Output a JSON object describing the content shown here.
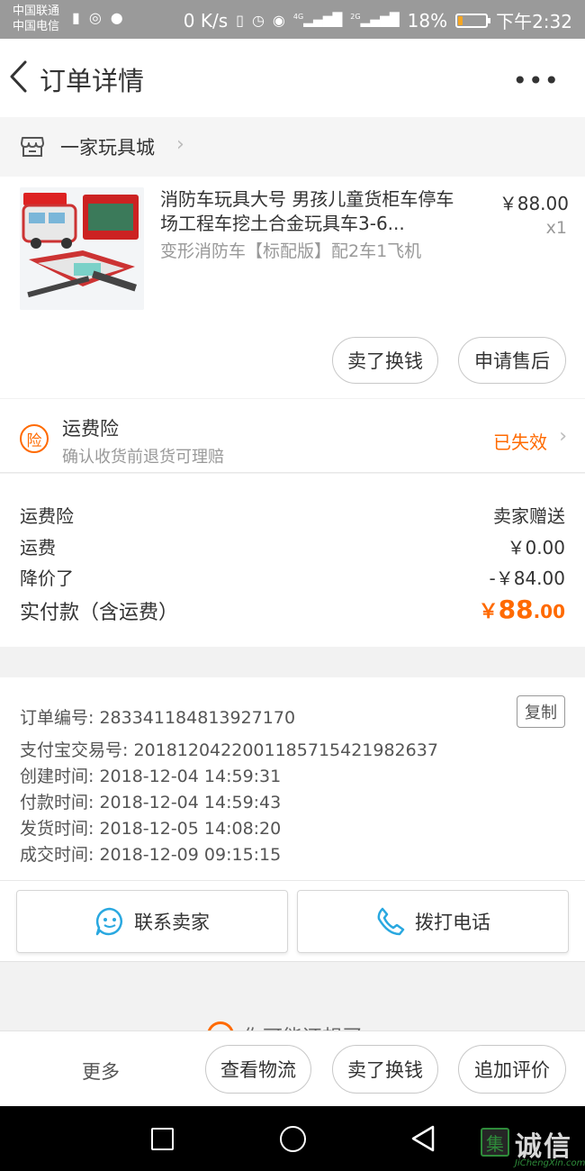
{
  "status_bar": {
    "carrier_1": "中国联通",
    "carrier_2": "中国电信",
    "speed": "0 K/s",
    "net_1": "4G",
    "net_2": "2G",
    "battery": "18%",
    "battery_level": 0.18,
    "time": "下午2:32"
  },
  "header": {
    "title": "订单详情",
    "more": "•••"
  },
  "store": {
    "name": "一家玩具城"
  },
  "product": {
    "title": "消防车玩具大号 男孩儿童货柜车停车场工程车挖土合金玩具车3-6...",
    "sku": "变形消防车【标配版】配2车1飞机",
    "price": "￥88.00",
    "qty": "x1",
    "actions": [
      "卖了换钱",
      "申请售后"
    ]
  },
  "insurance": {
    "badge": "险",
    "title": "运费险",
    "subtitle": "确认收货前退货可理赔",
    "status": "已失效"
  },
  "fees": {
    "rows": [
      {
        "label": "运费险",
        "value": "卖家赠送"
      },
      {
        "label": "运费",
        "value": "￥0.00"
      },
      {
        "label": "降价了",
        "value": "-￥84.00"
      }
    ],
    "total_label": "实付款（含运费）",
    "total_currency": "￥",
    "total_int": "88",
    "total_dec": ".00"
  },
  "order_info": {
    "copy": "复制",
    "lines": [
      "订单编号: 283341184813927170",
      "支付宝交易号: 2018120422001185715421982637",
      "创建时间: 2018-12-04 14:59:31",
      "付款时间: 2018-12-04 14:59:43",
      "发货时间: 2018-12-05 14:08:20",
      "成交时间: 2018-12-09 09:15:15"
    ]
  },
  "contact": {
    "seller": "联系卖家",
    "phone": "拨打电话"
  },
  "recommend": {
    "text": "你可能还想买"
  },
  "bottom_bar": {
    "more": "更多",
    "buttons": [
      "查看物流",
      "卖了换钱",
      "追加评价"
    ]
  },
  "watermark": {
    "logo_char": "集",
    "text": "诚信",
    "url": "JiChengXin.com"
  },
  "colors": {
    "accent": "#ff6a00",
    "contact_icon": "#29a8e0"
  }
}
